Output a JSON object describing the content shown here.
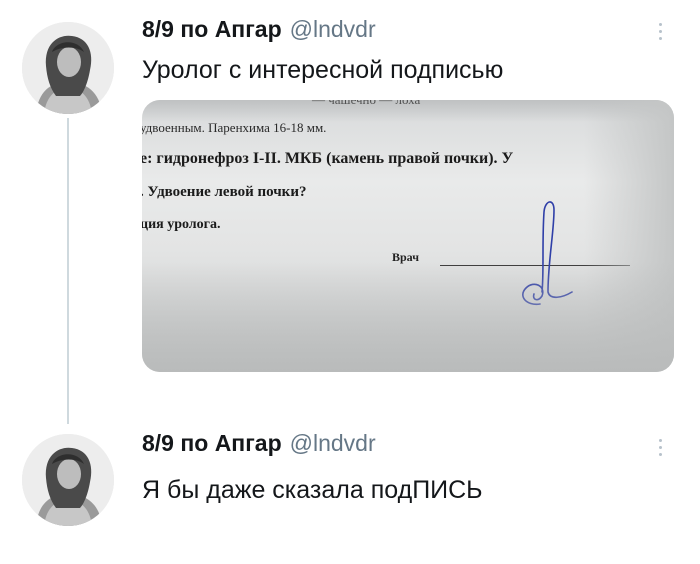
{
  "thread": {
    "tweets": [
      {
        "author": {
          "display_name": "8/9 по Апгар",
          "handle": "@lndvdr",
          "avatar": "profile-photo"
        },
        "text": "Уролог с интересной подписью",
        "media": {
          "kind": "photo-of-medical-document",
          "lines": [
            "— чашечно — лоха",
            "удвоенным. Паренхима 16-18 мм.",
            "е:   гидронефроз I-II. МКБ (камень правой почки). У",
            ". Удвоение левой почки?",
            "ция уролога."
          ],
          "doctor_label": "Врач"
        }
      },
      {
        "author": {
          "display_name": "8/9 по Апгар",
          "handle": "@lndvdr",
          "avatar": "profile-photo"
        },
        "text": "Я бы даже сказала подПИСЬ"
      }
    ]
  },
  "icons": {
    "more": "more-vertical-icon"
  },
  "colors": {
    "text": "#14171a",
    "handle": "#657786",
    "thread_line": "#cfd9de",
    "more_dots": "#b7c2cb"
  }
}
